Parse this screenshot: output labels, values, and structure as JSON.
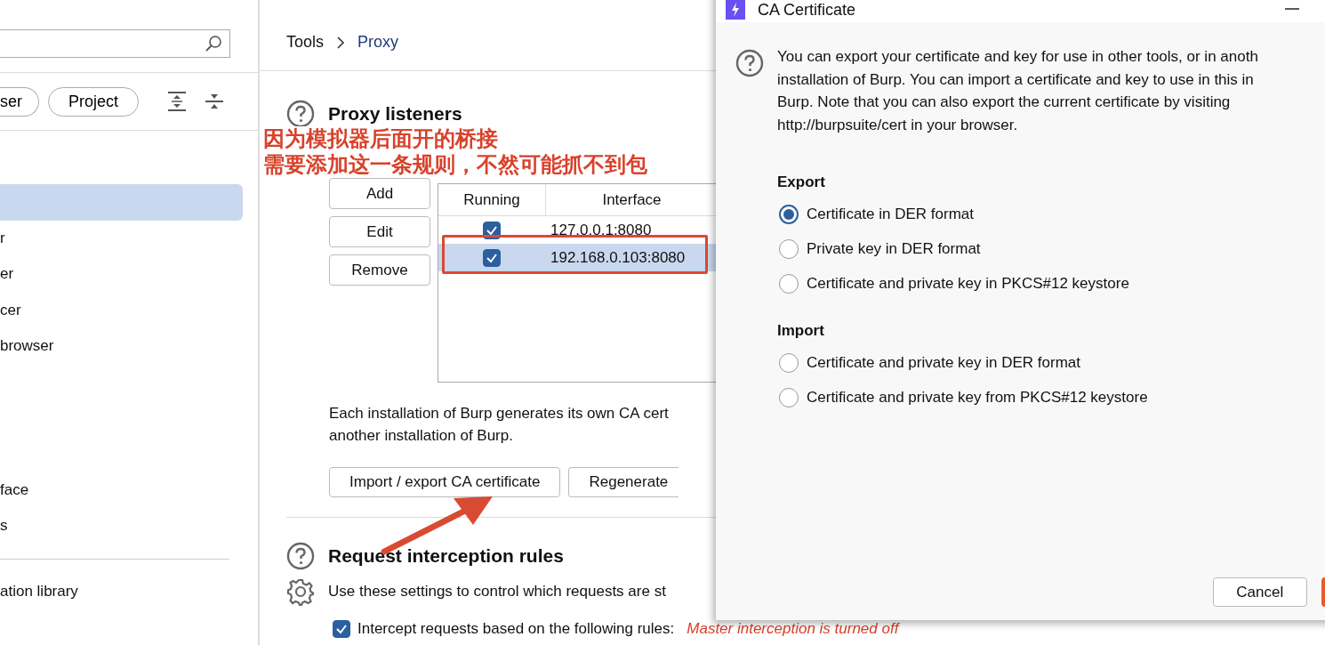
{
  "sidebar": {
    "filters": [
      {
        "label": "ser"
      },
      {
        "label": "Project"
      }
    ],
    "groups": [
      {
        "items": [
          {
            "selected": true
          },
          {
            "label": "r",
            "selected": false
          },
          {
            "label": "er",
            "selected": false
          },
          {
            "label": "cer",
            "selected": false
          },
          {
            "label": "browser",
            "selected": false
          }
        ]
      },
      {
        "items": [
          {
            "label": "face",
            "selected": false
          },
          {
            "label": "s",
            "selected": false
          }
        ]
      }
    ],
    "footer_item": "ation library"
  },
  "breadcrumb": [
    "Tools",
    "Proxy"
  ],
  "proxy_listeners": {
    "title": "Proxy listeners",
    "buttons": [
      "Add",
      "Edit",
      "Remove"
    ],
    "columns": [
      "Running",
      "Interface"
    ],
    "rows": [
      {
        "running": true,
        "interface": "127.0.0.1:8080",
        "selected": false
      },
      {
        "running": true,
        "interface": "192.168.0.103:8080",
        "selected": true
      }
    ],
    "ca_text_lines": [
      "Each installation of Burp generates its own CA cert",
      "another installation of Burp."
    ],
    "ca_buttons": [
      "Import / export CA certificate",
      "Regenerate"
    ]
  },
  "interception": {
    "title": "Request interception rules",
    "description": "Use these settings to control which requests are st",
    "checkbox": {
      "label": "Intercept requests based on the following rules:",
      "checked": true
    },
    "status": "Master interception is turned off"
  },
  "annotation": {
    "lines": [
      "因为模拟器后面开的桥接",
      "需要添加这一条规则，不然可能抓不到包"
    ]
  },
  "dialog": {
    "title": "CA Certificate",
    "description_lines": [
      "You can export your certificate and key for use in other tools, or in anoth",
      "installation of Burp. You can import a certificate and key to use in this in",
      "Burp. Note that you can also export the current certificate by visiting",
      "http://burpsuite/cert in your browser."
    ],
    "groups": [
      {
        "heading": "Export",
        "options": [
          {
            "label": "Certificate in DER format",
            "selected": true
          },
          {
            "label": "Private key in DER format",
            "selected": false
          },
          {
            "label": "Certificate and private key in PKCS#12 keystore",
            "selected": false
          }
        ]
      },
      {
        "heading": "Import",
        "options": [
          {
            "label": "Certificate and private key in DER format",
            "selected": false
          },
          {
            "label": "Certificate and private key from PKCS#12 keystore",
            "selected": false
          }
        ]
      }
    ],
    "buttons": [
      "Cancel"
    ]
  }
}
